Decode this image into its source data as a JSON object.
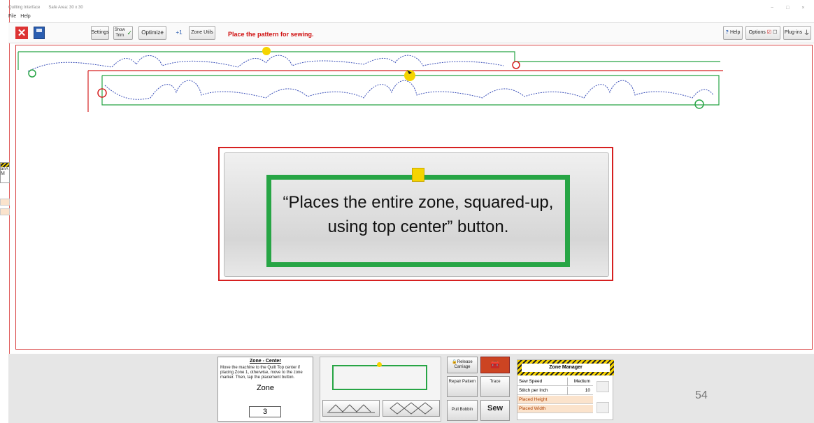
{
  "window": {
    "title": "Quilting Interface",
    "subtitle": "Safe Area: 30 x 30",
    "controls": [
      "−",
      "□",
      "×"
    ]
  },
  "menu": {
    "items": [
      "File",
      "Help"
    ]
  },
  "toolbar": {
    "settings_label": "Settings",
    "show_trim_label": "Show Trim",
    "optimize_label": "Optimize",
    "plus_one_label": "+1",
    "zone_utils_label": "Zone Utils",
    "status_message": "Place the pattern for sewing.",
    "help_label": "Help",
    "options_label": "Options",
    "plugins_label": "Plug-ins"
  },
  "left_widget": {
    "label_a": "anA",
    "label_b": "M"
  },
  "popup": {
    "caption": "“Places the entire zone, squared-up, using top center” button."
  },
  "zone_panel": {
    "title": "Zone - Center",
    "description": "Move the machine to the Quilt Top center if placing Zone 1, otherwise, move to the zone marker. Then, tap the placement button.",
    "zone_label": "Zone",
    "zone_value": "3"
  },
  "tools": {
    "release_carriage": "Release Carriage",
    "repair_pattern": "Repair Pattern",
    "trace": "Trace",
    "pull_bobbin": "Pull Bobbin",
    "sew": "Sew"
  },
  "zone_manager": {
    "title": "Zone Manager",
    "rows": [
      {
        "key": "Sew Speed",
        "value": "Medium"
      },
      {
        "key": "Stitch per Inch",
        "value": "10"
      },
      {
        "key": "Placed Height",
        "value": ""
      },
      {
        "key": "Placed Width",
        "value": ""
      }
    ]
  },
  "slide": {
    "page_number": "54"
  },
  "colors": {
    "zone_outline": "#27a545",
    "status_red": "#d01010",
    "marker_yellow": "#f5d400",
    "guide_red": "#d62020",
    "stitch_blue": "#3a4fb8"
  }
}
